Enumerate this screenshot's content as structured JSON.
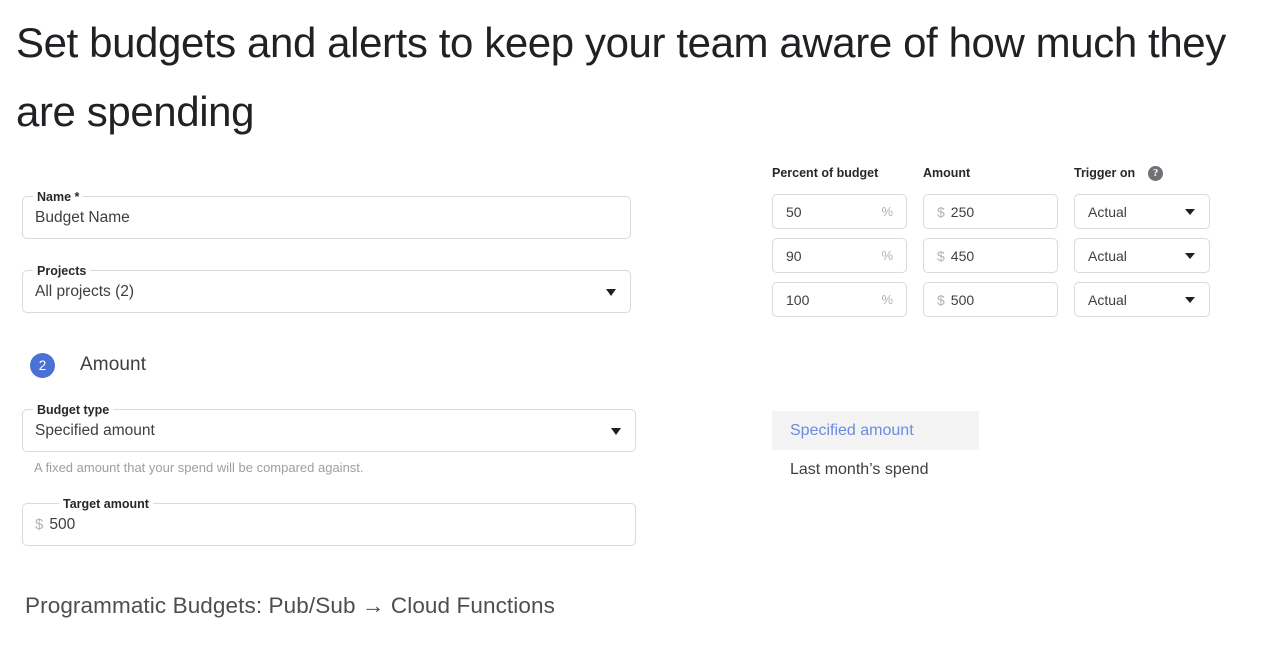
{
  "slide": {
    "title": "Set budgets and alerts to keep your team aware of how much they are spending",
    "footer_caption": "Programmatic Budgets: Pub/Sub → Cloud Functions"
  },
  "form": {
    "name_field": {
      "label": "Name *",
      "value": "Budget Name",
      "placeholder": "Budget Name"
    },
    "projects_field": {
      "label": "Projects",
      "value": "All projects (2)",
      "caret_icon": "chevron-down-icon"
    },
    "step": {
      "number": "2",
      "title": "Amount",
      "badge_color": "#4a72d4"
    },
    "budget_type_field": {
      "label": "Budget type",
      "value": "Specified amount",
      "caret_icon": "chevron-down-icon",
      "helper_text": "A fixed amount that your spend will be compared against."
    },
    "target_amount_field": {
      "label": "Target amount",
      "currency_prefix": "$",
      "value": "500"
    }
  },
  "rules_table": {
    "headers": {
      "percent": "Percent of budget",
      "amount": "Amount",
      "trigger": "Trigger on",
      "help_icon": "help-circle-icon"
    },
    "percent_suffix": "%",
    "currency_prefix": "$",
    "rows": [
      {
        "percent": "50",
        "amount": "250",
        "trigger": "Actual"
      },
      {
        "percent": "90",
        "amount": "450",
        "trigger": "Actual"
      },
      {
        "percent": "100",
        "amount": "500",
        "trigger": "Actual"
      }
    ]
  },
  "budget_type_options": {
    "items": [
      {
        "label": "Specified amount",
        "selected": true
      },
      {
        "label": "Last month’s spend",
        "selected": false
      }
    ],
    "selected_color": "#6b8bdd",
    "selected_bg": "#f3f3f4"
  }
}
